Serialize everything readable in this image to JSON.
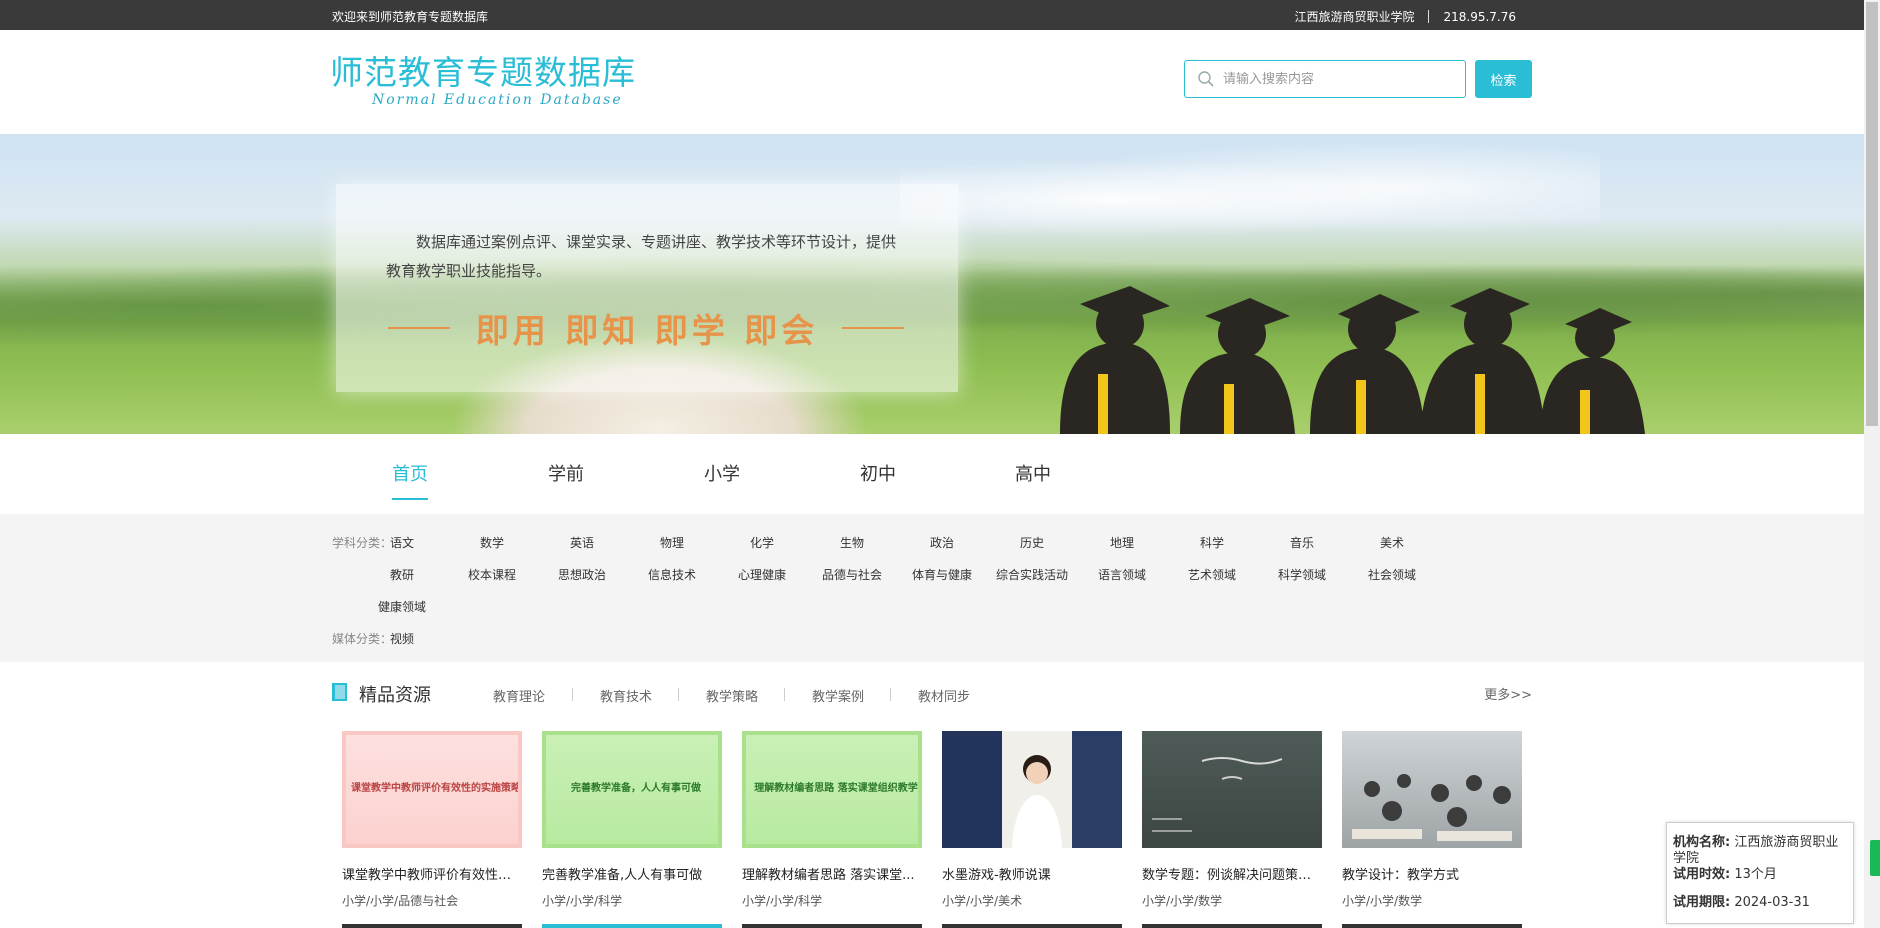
{
  "topbar": {
    "welcome": "欢迎来到师范教育专题数据库",
    "institution": "江西旅游商贸职业学院",
    "ip": "218.95.7.76"
  },
  "header": {
    "logo_cn": "师范教育专题数据库",
    "logo_en": "Normal Education Database",
    "search_placeholder": "请输入搜索内容",
    "search_button": "检索"
  },
  "banner": {
    "intro": "数据库通过案例点评、课堂实录、专题讲座、教学技术等环节设计，提供教育教学职业技能指导。",
    "slogan": "即用 即知 即学 即会"
  },
  "nav": {
    "items": [
      {
        "label": "首页",
        "active": true
      },
      {
        "label": "学前"
      },
      {
        "label": "小学"
      },
      {
        "label": "初中"
      },
      {
        "label": "高中"
      }
    ]
  },
  "categories": {
    "subject_label": "学科分类：",
    "subjects": [
      "语文",
      "数学",
      "英语",
      "物理",
      "化学",
      "生物",
      "政治",
      "历史",
      "地理",
      "科学",
      "音乐",
      "美术",
      "教研",
      "校本课程",
      "思想政治",
      "信息技术",
      "心理健康",
      "品德与社会",
      "体育与健康",
      "综合实践活动",
      "语言领域",
      "艺术领域",
      "科学领域",
      "社会领域",
      "健康领域"
    ],
    "media_label": "媒体分类：",
    "media": [
      "视频"
    ]
  },
  "resources": {
    "title": "精品资源",
    "tabs": [
      "教育理论",
      "教育技术",
      "教学策略",
      "教学案例",
      "教材同步"
    ],
    "more": "更多>>",
    "cards": [
      {
        "name": "课堂教学中教师评价有效性的...",
        "path": "小学/小学/品德与社会",
        "thumb_caption": "课堂教学中教师评价有效性的实施策略"
      },
      {
        "name": "完善教学准备,人人有事可做",
        "path": "小学/小学/科学",
        "thumb_caption": "完善教学准备，人人有事可做"
      },
      {
        "name": "理解教材编者思路 落实课堂...",
        "path": "小学/小学/科学",
        "thumb_caption": "理解教材编者思路  落实课堂组织教学"
      },
      {
        "name": "水墨游戏-教师说课",
        "path": "小学/小学/美术",
        "thumb_caption": ""
      },
      {
        "name": "数学专题：例谈解决问题策略...",
        "path": "小学/小学/数学",
        "thumb_caption": ""
      },
      {
        "name": "教学设计：教学方式",
        "path": "小学/小学/数学",
        "thumb_caption": ""
      }
    ]
  },
  "infobox": {
    "name_label": "机构名称:",
    "name_value": "江西旅游商贸职业学院",
    "duration_label": "试用时效:",
    "duration_value": "13个月",
    "expiry_label": "试用期限:",
    "expiry_value": "2024-03-31"
  },
  "colors": {
    "accent": "#29bdd6",
    "slogan": "#e8934a",
    "topbar": "#3a3a3a"
  }
}
